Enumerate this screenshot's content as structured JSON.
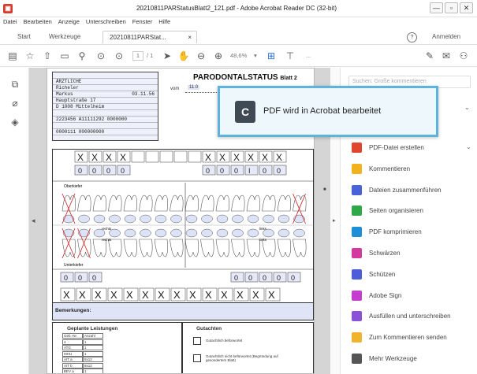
{
  "window": {
    "title": "20210811PARStatusBlatt2_121.pdf - Adobe Acrobat Reader DC (32-bit)",
    "app_icon": "acrobat-logo",
    "controls": [
      "—",
      "▫",
      "✕"
    ]
  },
  "menubar": [
    "Datei",
    "Bearbeiten",
    "Anzeige",
    "Unterschreiben",
    "Fenster",
    "Hilfe"
  ],
  "tabs": {
    "start": "Start",
    "werkzeuge": "Werkzeuge",
    "document": "20210811PARStat...",
    "document_close": "×",
    "help_icon": "?",
    "signin": "Anmelden"
  },
  "toolbar": {
    "page_current": "1",
    "page_total": "/ 1",
    "zoom": "48,6%",
    "more": "..."
  },
  "document": {
    "heading": "PARODONTALSTATUS",
    "heading_sub": "Blatt 2",
    "addr_lines": [
      "",
      "ÄRZTLICHE",
      "Richeler",
      "Markus",
      "Hauptstraße 17",
      "D 1008 Mittelheim",
      "",
      "2223456 A11111292  0000000",
      "",
      "0000111 000000000"
    ],
    "addr_date": "03.11.56",
    "patient_label": "vom",
    "patient_date": "11.0",
    "oberkiefer": "Oberkiefer",
    "unterkiefer": "Unterkiefer",
    "rechts": "rechts",
    "links": "links",
    "rechts2": "rechts",
    "links2": "links",
    "bemerkungen": "Bemerkungen:",
    "geplant": "Geplante Leistungen",
    "gutachten": "Gutachten",
    "geplant_rows": [
      "Geb.-Nr. | Anzahl",
      "4 | 1",
      "ATG | 1",
      "MHU | 1",
      "AIT a | 8x12",
      "AIT b | 8x12",
      "BEV a | 1"
    ],
    "gut_items": [
      "Gutachtlich befürwortet",
      "Gutachtlich nicht befürwortet (Begründung auf gesondertem Blatt)"
    ]
  },
  "toast": {
    "logo": "C",
    "message": "PDF wird in Acrobat bearbeitet"
  },
  "right_panel": {
    "search_placeholder": "Suchen: Große kommentieren",
    "items": [
      {
        "label": "PDF-Datei erstellen",
        "icon": "create-pdf-icon",
        "color": "#e0452e"
      },
      {
        "label": "Kommentieren",
        "icon": "comment-icon",
        "color": "#f2b21e"
      },
      {
        "label": "Dateien zusammenführen",
        "icon": "combine-icon",
        "color": "#4a62d8"
      },
      {
        "label": "Seiten organisieren",
        "icon": "organize-icon",
        "color": "#2fa84a"
      },
      {
        "label": "PDF komprimieren",
        "icon": "compress-icon",
        "color": "#1e8fd6"
      },
      {
        "label": "Schwärzen",
        "icon": "redact-icon",
        "color": "#d33a9e"
      },
      {
        "label": "Schützen",
        "icon": "protect-icon",
        "color": "#4d5cd9"
      },
      {
        "label": "Adobe Sign",
        "icon": "sign-icon",
        "color": "#c43dcf"
      },
      {
        "label": "Ausfüllen und unterschreiben",
        "icon": "fill-sign-icon",
        "color": "#8a52d6"
      },
      {
        "label": "Zum Kommentieren senden",
        "icon": "send-comment-icon",
        "color": "#f0b32b"
      },
      {
        "label": "Mehr Werkzeuge",
        "icon": "more-tools-icon",
        "color": "#555555"
      }
    ]
  },
  "teeth_marks": {
    "top_row": [
      "X",
      "X",
      "X",
      "X",
      "",
      "",
      "",
      "",
      "",
      "X",
      "X",
      "X",
      "X",
      "X",
      "X"
    ],
    "top_values_left": [
      "0",
      "0",
      "0",
      "0"
    ],
    "top_values_right": [
      "0",
      "0",
      "0",
      "I",
      "0",
      "0"
    ],
    "bottom_values_left": [
      "0",
      "0",
      "0"
    ],
    "bottom_values_right": [
      "0",
      "0",
      "0",
      "0",
      "0"
    ],
    "bottom_row": [
      "X",
      "X",
      "X",
      "X",
      "X",
      "X",
      "X",
      "X",
      "X",
      "X",
      "X",
      "X",
      "X",
      "X"
    ]
  }
}
